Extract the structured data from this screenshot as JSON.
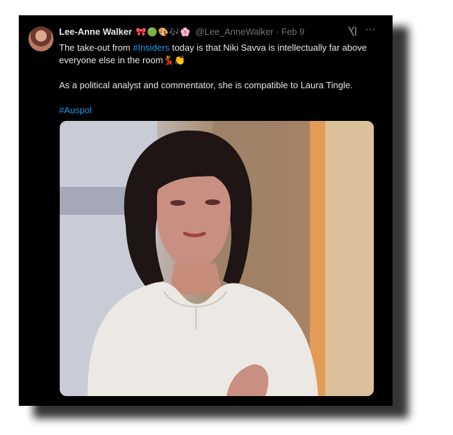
{
  "tweet": {
    "author_name": "Lee-Anne Walker",
    "emojis": "🎀🟢🎨🎶🌸",
    "handle": "@Lee_AnneWalker",
    "separator": "·",
    "date": "Feb 9",
    "text_part1": "The take-out from ",
    "hashtag_insiders": "#Insiders",
    "text_part2": " today is that Niki Savva is intellectually far above everyone else in the room",
    "text_emojis": "💃👏",
    "paragraph2": "As a political analyst and commentator, she is compatible to Laura Tingle.",
    "hashtag_auspol": "#Auspol",
    "more_icon": "⋯"
  },
  "icons": {
    "grok": "grok-icon",
    "more": "more-options-icon"
  },
  "colors": {
    "background": "#000000",
    "text": "#e7e9ea",
    "muted": "#71767b",
    "link": "#1d9bf0"
  }
}
